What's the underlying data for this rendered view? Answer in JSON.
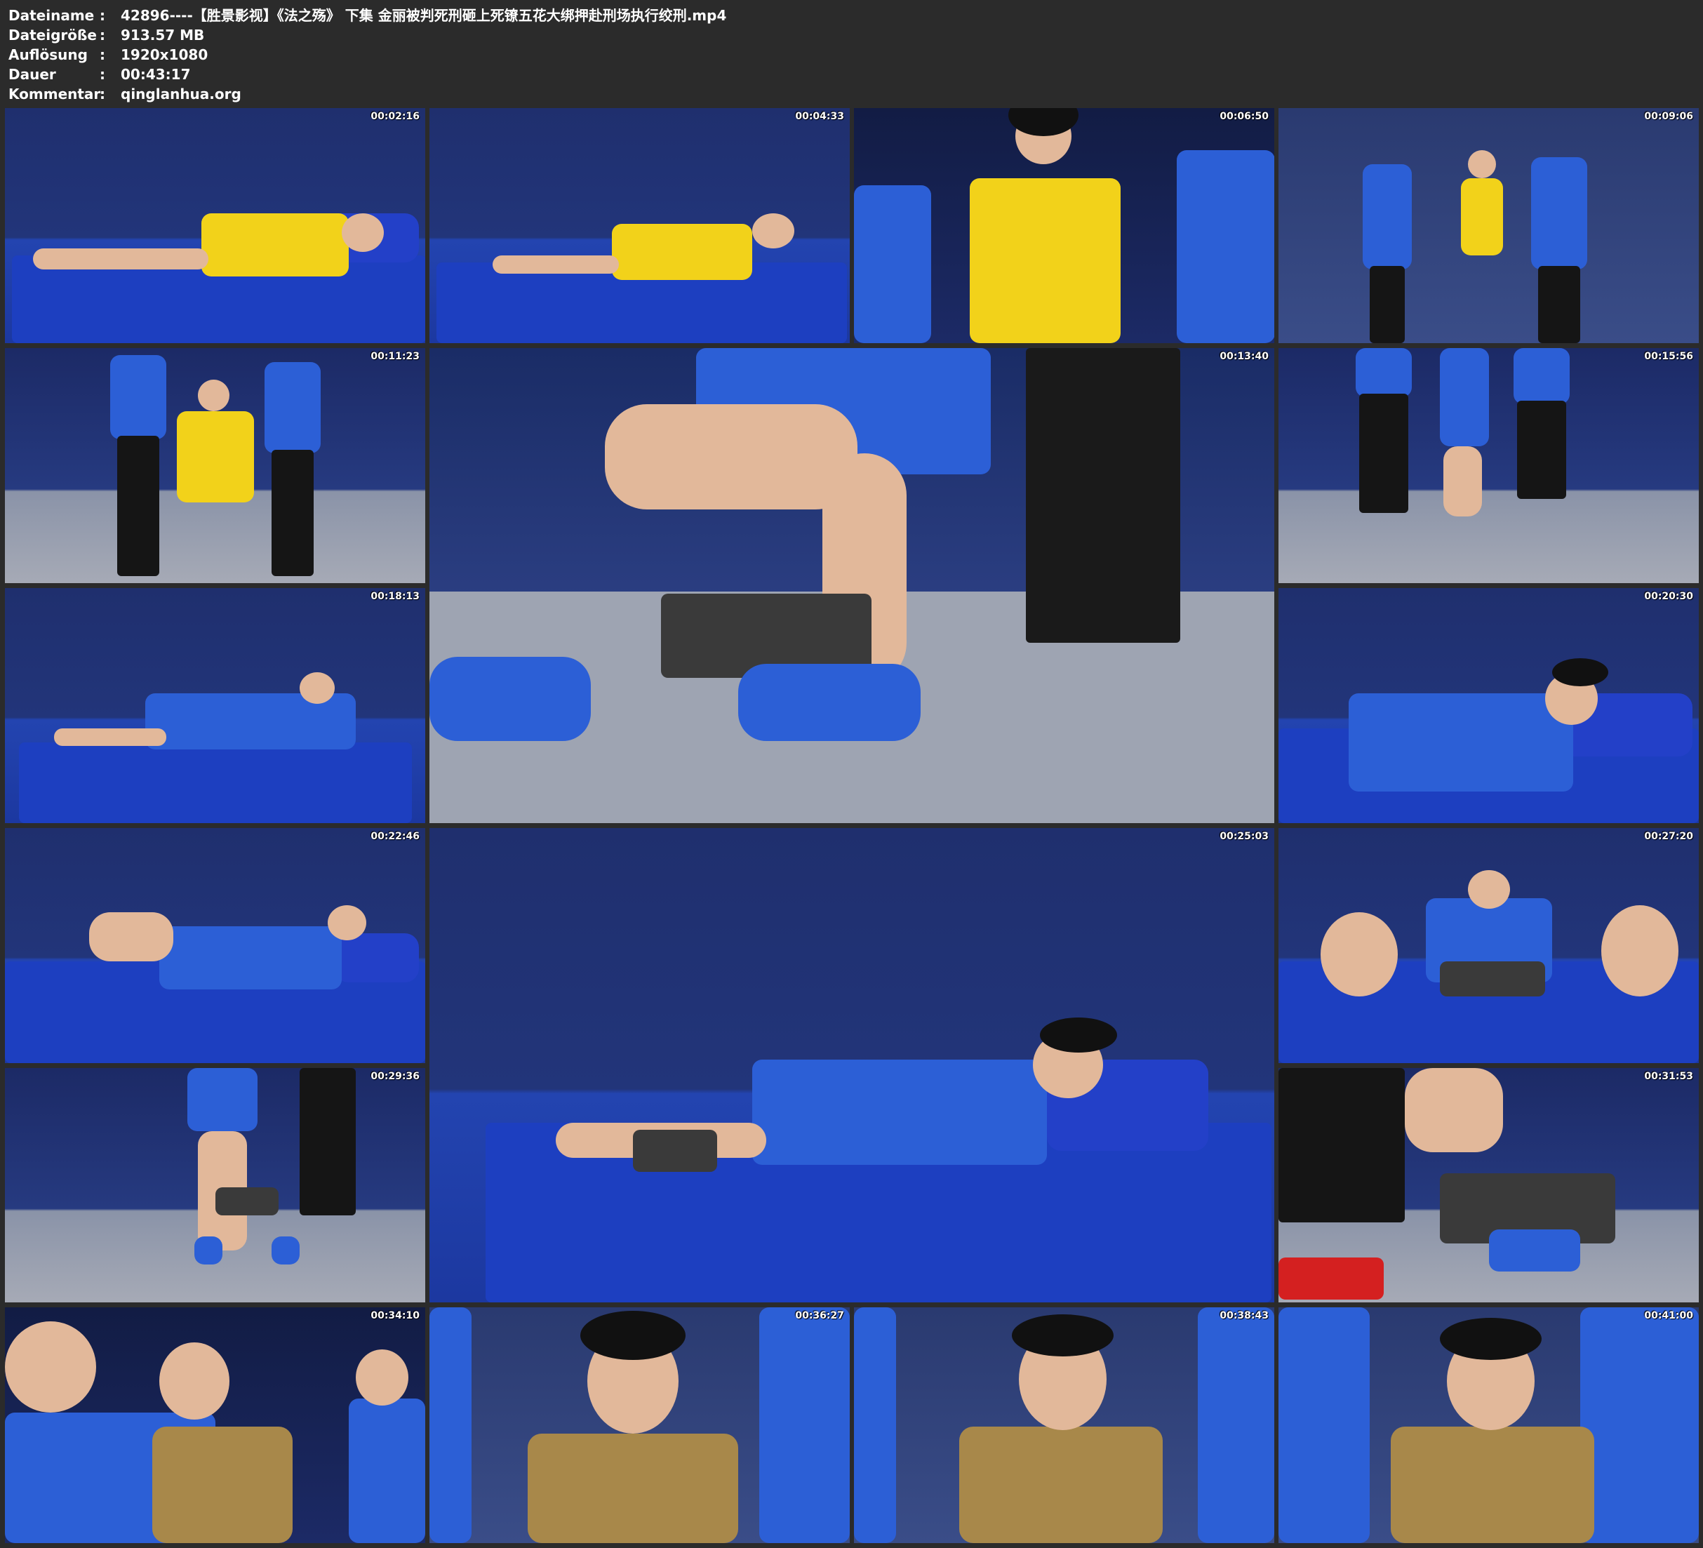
{
  "header": {
    "rows": [
      {
        "label": "Dateiname",
        "sep": ":",
        "value": "42896----【胜景影视】《法之殇》 下集 金丽被判死刑砸上死镣五花大绑押赴刑场执行绞刑.mp4"
      },
      {
        "label": "Dateigröße",
        "sep": ":",
        "value": "913.57 MB"
      },
      {
        "label": "Auflösung",
        "sep": ":",
        "value": "1920x1080"
      },
      {
        "label": "Dauer",
        "sep": ":",
        "value": "00:43:17"
      },
      {
        "label": "Kommentar",
        "sep": ":",
        "value": "qinglanhua.org"
      }
    ]
  },
  "thumbnails": [
    {
      "timestamp": "00:02:16"
    },
    {
      "timestamp": "00:04:33"
    },
    {
      "timestamp": "00:06:50"
    },
    {
      "timestamp": "00:09:06"
    },
    {
      "timestamp": "00:11:23"
    },
    {
      "timestamp": "00:13:40"
    },
    {
      "timestamp": "00:15:56"
    },
    {
      "timestamp": "00:18:13"
    },
    {
      "timestamp": "00:20:30"
    },
    {
      "timestamp": "00:22:46"
    },
    {
      "timestamp": "00:25:03"
    },
    {
      "timestamp": "00:27:20"
    },
    {
      "timestamp": "00:29:36"
    },
    {
      "timestamp": "00:31:53"
    },
    {
      "timestamp": "00:34:10"
    },
    {
      "timestamp": "00:36:27"
    },
    {
      "timestamp": "00:38:43"
    },
    {
      "timestamp": "00:41:00"
    }
  ]
}
